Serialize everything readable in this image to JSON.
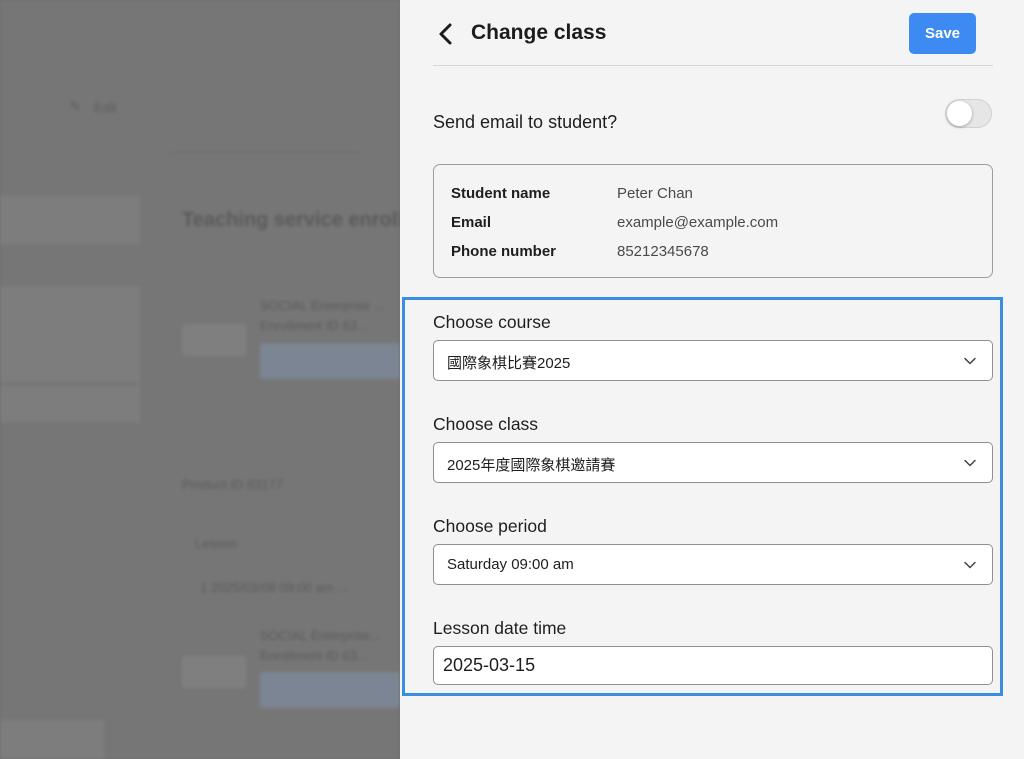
{
  "background_page": {
    "edit_label": "Edit",
    "section_title": "Teaching service enrollment",
    "row1_name": "SOCIAL Enterprise ...",
    "row1_sub": "Enrollment ID 63...",
    "product_id": "Product ID 83177",
    "lesson_header": "Lesson",
    "lesson_item": "1  2025/03/08 09:00 am  ...",
    "row2_name": "SOCIAL Enterprise...",
    "row2_sub": "Enrollment ID 63..."
  },
  "drawer": {
    "title": "Change class",
    "save_label": "Save",
    "send_email_label": "Send email to student?",
    "send_email_enabled": false,
    "student": {
      "name_label": "Student name",
      "name_value": "Peter Chan",
      "email_label": "Email",
      "email_value": "example@example.com",
      "phone_label": "Phone number",
      "phone_value": "85212345678"
    },
    "course": {
      "label": "Choose course",
      "value": "國際象棋比賽2025"
    },
    "class": {
      "label": "Choose class",
      "value": "2025年度國際象棋邀請賽"
    },
    "period": {
      "label": "Choose period",
      "value": "Saturday 09:00 am"
    },
    "lesson_date": {
      "label": "Lesson date time",
      "value": "2025-03-15"
    }
  },
  "colors": {
    "accent": "#3d8bf2",
    "highlight_border": "#3a8de0",
    "overlay": "#767676",
    "drawer_bg": "#f4f4f4"
  },
  "icons": {
    "back": "chevron-left-icon",
    "dropdown": "chevron-down-icon",
    "edit": "pencil-icon"
  }
}
